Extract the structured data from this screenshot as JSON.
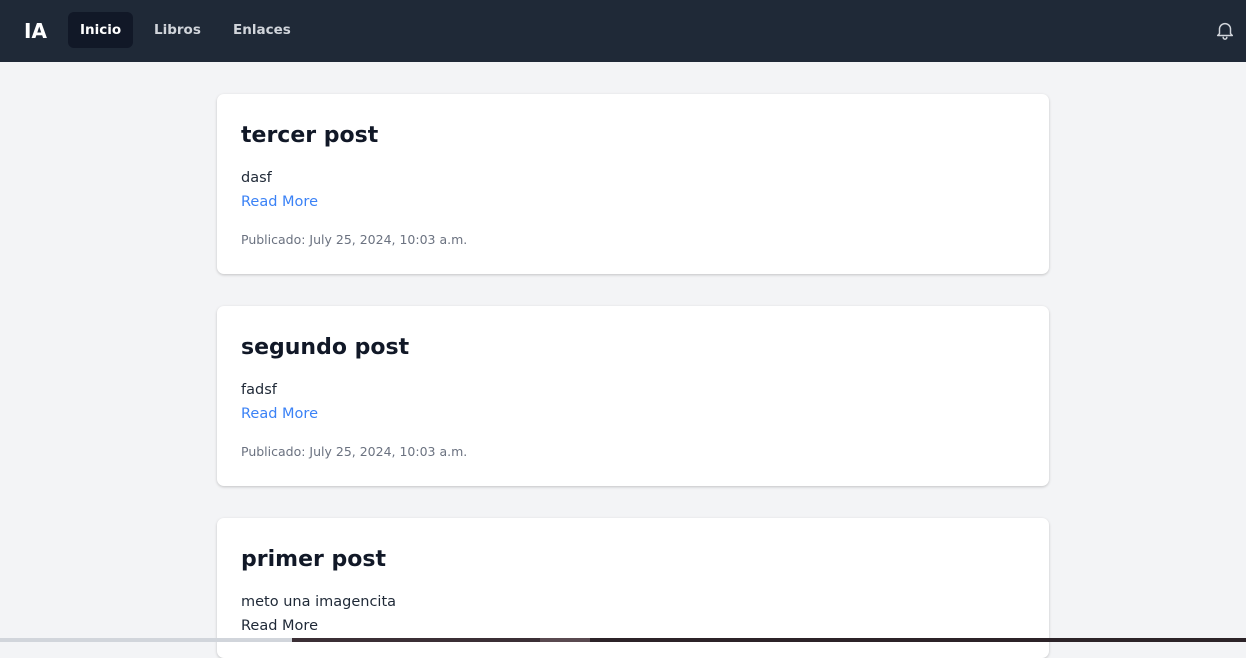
{
  "navbar": {
    "brand": "IA",
    "links": [
      {
        "label": "Inicio",
        "active": true
      },
      {
        "label": "Libros",
        "active": false
      },
      {
        "label": "Enlaces",
        "active": false
      }
    ],
    "notification_icon": "bell-icon"
  },
  "posts": [
    {
      "title": "tercer post",
      "body": "dasf",
      "read_more": "Read More",
      "published": "Publicado: July 25, 2024, 10:03 a.m."
    },
    {
      "title": "segundo post",
      "body": "fadsf",
      "read_more": "Read More",
      "published": "Publicado: July 25, 2024, 10:03 a.m."
    },
    {
      "title": "primer post",
      "body": "meto una imagencita",
      "read_more": "Read More"
    }
  ],
  "colors": {
    "navbar": "#1f2937",
    "active_link_bg": "#111827",
    "link_accent": "#3b82f6",
    "page_bg": "#f3f4f6"
  }
}
